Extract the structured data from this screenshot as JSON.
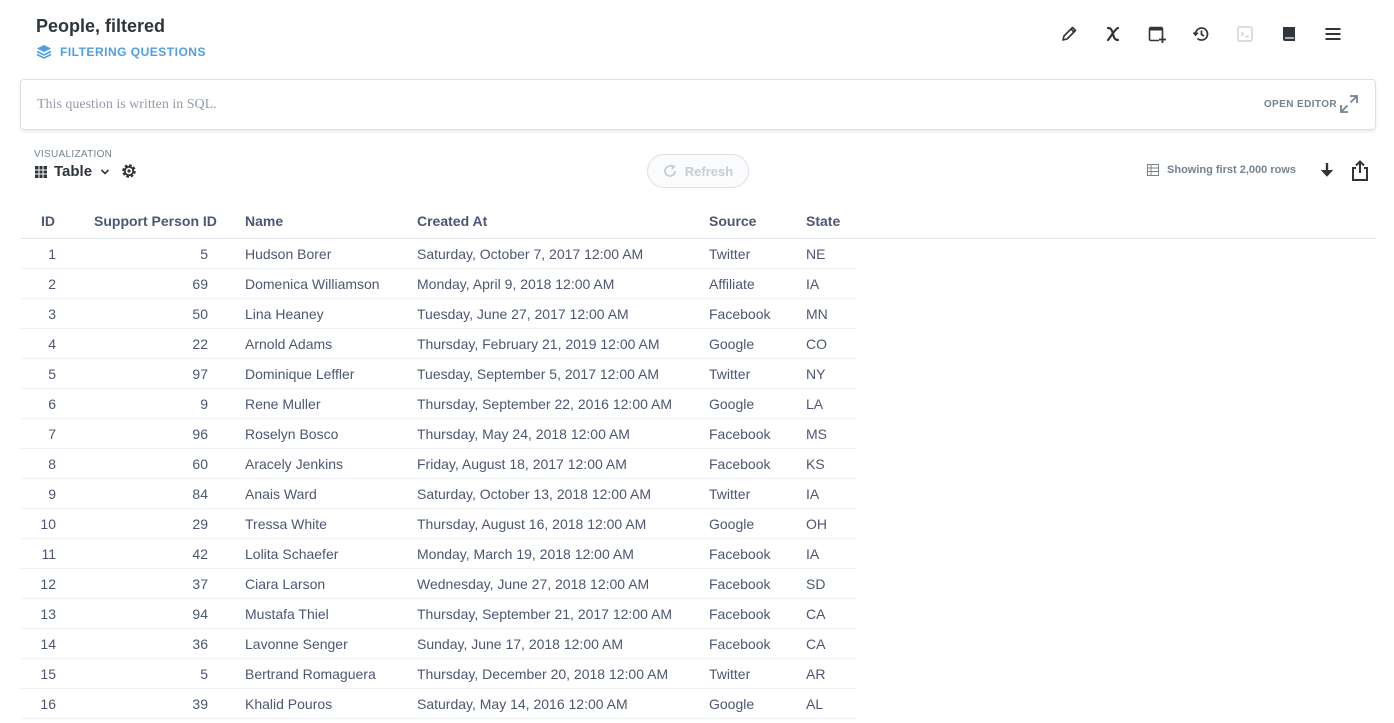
{
  "header": {
    "title": "People, filtered",
    "collection": "FILTERING QUESTIONS"
  },
  "toolbar": {
    "icons": [
      "pencil-icon",
      "variable-x-icon",
      "add-to-dashboard-icon",
      "history-icon",
      "sql-console-icon",
      "reference-book-icon",
      "menu-icon"
    ]
  },
  "editor": {
    "message": "This question is written in SQL.",
    "open_label": "OPEN EDITOR"
  },
  "visualization": {
    "label": "VISUALIZATION",
    "selected": "Table"
  },
  "refresh": {
    "label": "Refresh"
  },
  "rowcount": {
    "text": "Showing first 2,000 rows"
  },
  "table": {
    "columns": [
      "ID",
      "Support Person ID",
      "Name",
      "Created At",
      "Source",
      "State"
    ],
    "rows": [
      [
        "1",
        "5",
        "Hudson Borer",
        "Saturday, October 7, 2017 12:00 AM",
        "Twitter",
        "NE"
      ],
      [
        "2",
        "69",
        "Domenica Williamson",
        "Monday, April 9, 2018 12:00 AM",
        "Affiliate",
        "IA"
      ],
      [
        "3",
        "50",
        "Lina Heaney",
        "Tuesday, June 27, 2017 12:00 AM",
        "Facebook",
        "MN"
      ],
      [
        "4",
        "22",
        "Arnold Adams",
        "Thursday, February 21, 2019 12:00 AM",
        "Google",
        "CO"
      ],
      [
        "5",
        "97",
        "Dominique Leffler",
        "Tuesday, September 5, 2017 12:00 AM",
        "Twitter",
        "NY"
      ],
      [
        "6",
        "9",
        "Rene Muller",
        "Thursday, September 22, 2016 12:00 AM",
        "Google",
        "LA"
      ],
      [
        "7",
        "96",
        "Roselyn Bosco",
        "Thursday, May 24, 2018 12:00 AM",
        "Facebook",
        "MS"
      ],
      [
        "8",
        "60",
        "Aracely Jenkins",
        "Friday, August 18, 2017 12:00 AM",
        "Facebook",
        "KS"
      ],
      [
        "9",
        "84",
        "Anais Ward",
        "Saturday, October 13, 2018 12:00 AM",
        "Twitter",
        "IA"
      ],
      [
        "10",
        "29",
        "Tressa White",
        "Thursday, August 16, 2018 12:00 AM",
        "Google",
        "OH"
      ],
      [
        "11",
        "42",
        "Lolita Schaefer",
        "Monday, March 19, 2018 12:00 AM",
        "Facebook",
        "IA"
      ],
      [
        "12",
        "37",
        "Ciara Larson",
        "Wednesday, June 27, 2018 12:00 AM",
        "Facebook",
        "SD"
      ],
      [
        "13",
        "94",
        "Mustafa Thiel",
        "Thursday, September 21, 2017 12:00 AM",
        "Facebook",
        "CA"
      ],
      [
        "14",
        "36",
        "Lavonne Senger",
        "Sunday, June 17, 2018 12:00 AM",
        "Facebook",
        "CA"
      ],
      [
        "15",
        "5",
        "Bertrand Romaguera",
        "Thursday, December 20, 2018 12:00 AM",
        "Twitter",
        "AR"
      ],
      [
        "16",
        "39",
        "Khalid Pouros",
        "Saturday, May 14, 2016 12:00 AM",
        "Google",
        "AL"
      ]
    ]
  }
}
